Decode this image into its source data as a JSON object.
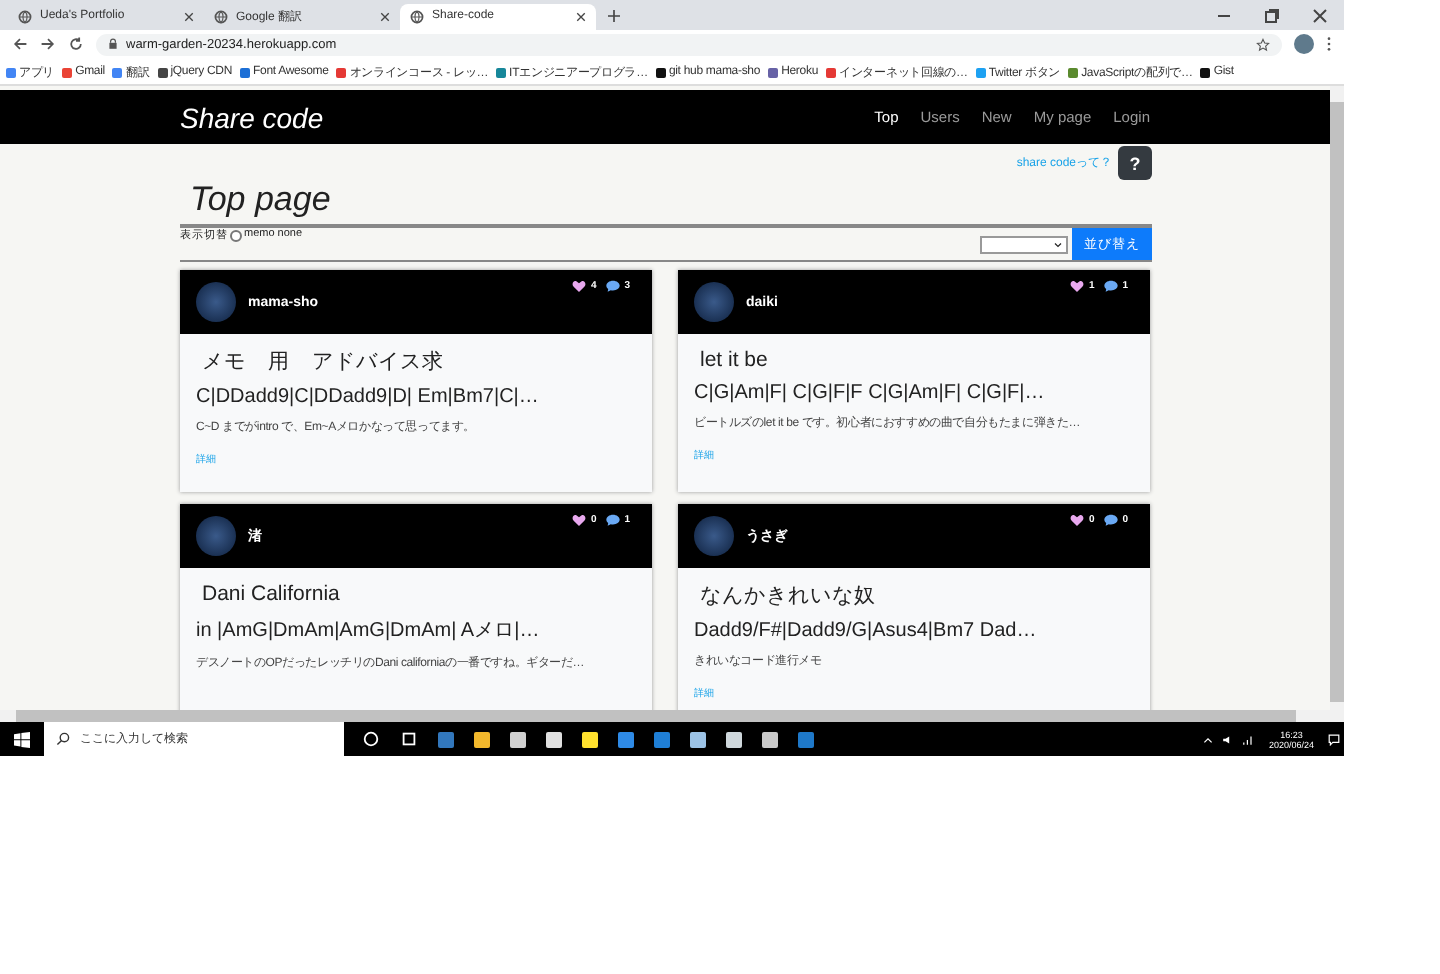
{
  "browser": {
    "tabs": [
      {
        "title": "Ueda's Portfolio",
        "selected": false
      },
      {
        "title": "Google 翻訳",
        "selected": false
      },
      {
        "title": "Share-code",
        "selected": true
      }
    ],
    "url": "warm-garden-20234.herokuapp.com",
    "bookmarks": [
      {
        "label": "アプリ",
        "color": "#4285f4"
      },
      {
        "label": "Gmail",
        "color": "#ea4335"
      },
      {
        "label": "翻訳",
        "color": "#4285f4"
      },
      {
        "label": "jQuery CDN",
        "color": "#444444"
      },
      {
        "label": "Font Awesome",
        "color": "#1c6fd6"
      },
      {
        "label": "オンラインコース - レッ…",
        "color": "#e53935"
      },
      {
        "label": "ITエンジニアープログラ…",
        "color": "#17879a"
      },
      {
        "label": "git hub mama-sho",
        "color": "#111111"
      },
      {
        "label": "Heroku",
        "color": "#6762a6"
      },
      {
        "label": "インターネット回線の…",
        "color": "#e53935"
      },
      {
        "label": "Twitter ボタン",
        "color": "#1da1f2"
      },
      {
        "label": "JavaScriptの配列で…",
        "color": "#5a8a2e"
      },
      {
        "label": "Gist",
        "color": "#111111"
      }
    ]
  },
  "site": {
    "brand": "Share code",
    "nav": [
      {
        "label": "Top",
        "selected": true
      },
      {
        "label": "Users",
        "selected": false
      },
      {
        "label": "New",
        "selected": false
      },
      {
        "label": "My page",
        "selected": false
      },
      {
        "label": "Login",
        "selected": false
      }
    ],
    "help_link": "share codeって？",
    "help_button": "?",
    "heading": "Top page",
    "toggle_label": "表示切替",
    "toggle_option": {
      "label": "memo none",
      "selected": false
    },
    "sort_button": "並び替え",
    "posts": [
      {
        "user": "mama-sho",
        "likes": "4",
        "comments": "3",
        "title": "メモ　用　アドバイス求",
        "chords": "C|DDadd9|C|DDadd9|D| Em|Bm7|C|…",
        "memo": "C~D までがintro で、Em~Aメロかなって思ってます。",
        "link": "詳細"
      },
      {
        "user": "daiki",
        "likes": "1",
        "comments": "1",
        "title": "let it be",
        "chords": "C|G|Am|F| C|G|F|F C|G|Am|F| C|G|F|…",
        "memo": "ビートルズのlet it be です。初心者におすすめの曲で自分もたまに弾きた…",
        "link": "詳細"
      },
      {
        "user": "渚",
        "likes": "0",
        "comments": "1",
        "title": "Dani California",
        "chords": "in |AmG|DmAm|AmG|DmAm| Aメロ|…",
        "memo": "デスノートのOPだったレッチリのDani californiaの一番ですね。ギターだ…"
      },
      {
        "user": "うさぎ",
        "likes": "0",
        "comments": "0",
        "title": "なんかきれいな奴",
        "chords": "Dadd9/F#|Dadd9/G|Asus4|Bm7 Dad…",
        "memo": "きれいなコード進行メモ",
        "link": "詳細"
      }
    ]
  },
  "taskbar": {
    "search_placeholder": "ここに入力して検索",
    "time": "16:23",
    "date": "2020/06/24"
  }
}
